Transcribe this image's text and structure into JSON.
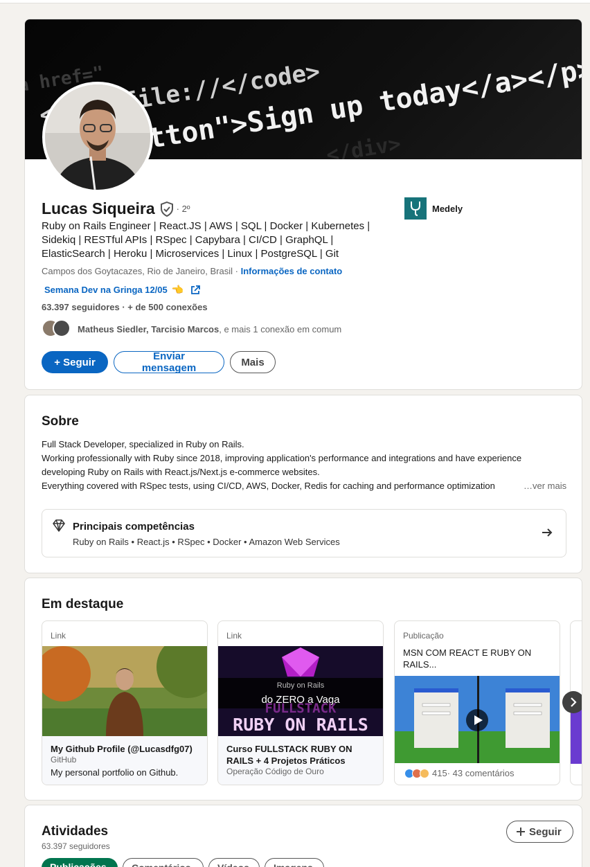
{
  "banner": {
    "code_lines": [
      "<code>file://</code>",
      "tton\">Sign up today</a></p>"
    ]
  },
  "profile": {
    "name": "Lucas Siqueira",
    "degree": "· 2º",
    "headline": "Ruby on Rails Engineer | React.JS | AWS | SQL | Docker | Kubernetes | Sidekiq | RESTful APIs | RSpec | Capybara | CI/CD | GraphQL | ElasticSearch | Heroku | Microservices | Linux | PostgreSQL | Git",
    "location": "Campos dos Goytacazes, Rio de Janeiro, Brasil",
    "location_sep": " · ",
    "contact_info": "Informações de contato",
    "custom_link": "Semana Dev na Gringa 12/05",
    "custom_link_emoji": "👈",
    "followers": "63.397 seguidores",
    "connections": " · + de 500 conexões",
    "mutual_names": "Matheus Siedler, Tarcisio Marcos",
    "mutual_rest": ", e mais 1 conexão em comum",
    "company": "Medely",
    "buttons": {
      "follow": "+ Seguir",
      "message": "Enviar mensagem",
      "more": "Mais"
    }
  },
  "about": {
    "title": "Sobre",
    "lines": [
      "Full Stack Developer, specialized in Ruby on Rails.",
      "Working professionally with Ruby since 2018, improving application's performance and integrations and have experience",
      "developing Ruby on Rails with React.js/Next.js e-commerce websites.",
      "Everything covered with RSpec tests, using CI/CD, AWS, Docker, Redis for caching and performance optimization"
    ],
    "see_more": "…ver mais",
    "skills_title": "Principais competências",
    "skills_list": "Ruby on Rails • React.js • RSpec • Docker • Amazon Web Services"
  },
  "featured": {
    "title": "Em destaque",
    "items": [
      {
        "type": "Link",
        "title": "My Github Profile (@Lucasdfg07)",
        "source": "GitHub",
        "description": "My personal portfolio on Github."
      },
      {
        "type": "Link",
        "title": "Curso FULLSTACK RUBY ON RAILS + 4 Projetos Práticos",
        "source": "Operação Código de Ouro",
        "media_text": [
          "Ruby on Rails",
          "do ZERO a Vaga",
          "RUBY ON RAILS",
          "FULLSTACK"
        ]
      },
      {
        "type": "Publicação",
        "title": "MSN COM REACT E RUBY ON RAILS...",
        "reactions": "415",
        "comments": " · 43 comentários"
      }
    ]
  },
  "activity": {
    "title": "Atividades",
    "followers": "63.397 seguidores",
    "follow_button": "Seguir",
    "pills": [
      "Publicações",
      "Comentários",
      "Vídeos",
      "Imagens"
    ]
  },
  "colors": {
    "brand_blue": "#0a66c2",
    "active_pill": "#01754f",
    "company_logo": "#17737a",
    "banner_text": "#f2f2f2"
  },
  "icons": {
    "verify": "shield-check-icon",
    "external_link": "external-link-icon",
    "skills": "diamond-icon",
    "arrow": "arrow-right-icon",
    "play": "play-icon",
    "carousel": "chevron-right-icon"
  }
}
